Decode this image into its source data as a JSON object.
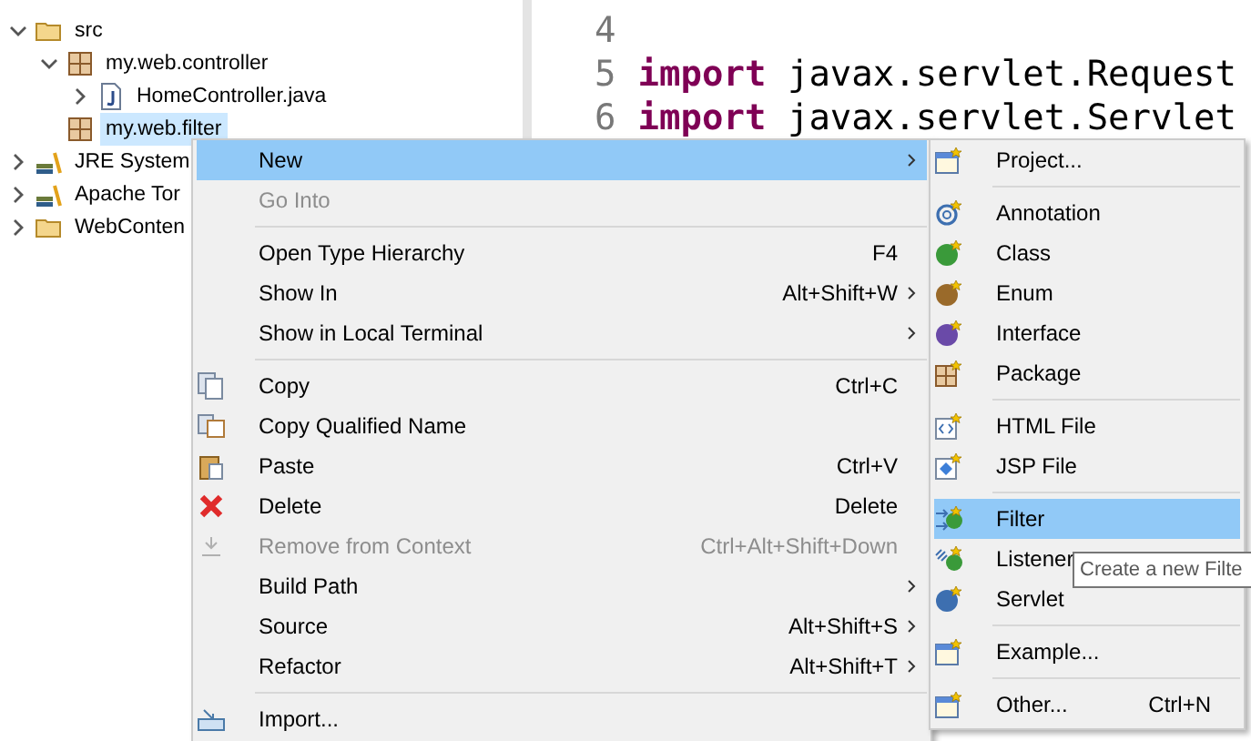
{
  "explorer": {
    "items": [
      {
        "label": "src",
        "kind": "folder",
        "expanded": true,
        "selected": false,
        "children": [
          {
            "label": "my.web.controller",
            "kind": "package",
            "expanded": true,
            "selected": false,
            "children": [
              {
                "label": "HomeController.java",
                "kind": "java",
                "expanded": false,
                "selected": false
              }
            ]
          },
          {
            "label": "my.web.filter",
            "kind": "package",
            "selected": true
          }
        ]
      },
      {
        "label": "JRE System",
        "kind": "library",
        "expanded": false,
        "selected": false
      },
      {
        "label": "Apache Tor",
        "kind": "library",
        "expanded": false,
        "selected": false
      },
      {
        "label": "WebConten",
        "kind": "folder",
        "expanded": false,
        "selected": false
      }
    ]
  },
  "editor": {
    "lines": [
      {
        "number": "4"
      },
      {
        "number": "5",
        "keyword": "import",
        "text": "javax.servlet.Request"
      },
      {
        "number": "6",
        "keyword": "import",
        "text": "javax.servlet.Servlet"
      }
    ]
  },
  "context_menu": {
    "items": [
      {
        "kind": "item",
        "label": "New",
        "selected": true,
        "disabled": false,
        "submenu": true
      },
      {
        "kind": "item",
        "label": "Go Into",
        "selected": false,
        "disabled": true,
        "submenu": false
      },
      {
        "kind": "separator"
      },
      {
        "kind": "item",
        "label": "Open Type Hierarchy",
        "shortcut": "F4",
        "selected": false,
        "disabled": false,
        "submenu": false
      },
      {
        "kind": "item",
        "label": "Show In",
        "shortcut": "Alt+Shift+W",
        "selected": false,
        "disabled": false,
        "submenu": true
      },
      {
        "kind": "item",
        "label": "Show in Local Terminal",
        "selected": false,
        "disabled": false,
        "submenu": true
      },
      {
        "kind": "separator"
      },
      {
        "kind": "item",
        "label": "Copy",
        "shortcut": "Ctrl+C",
        "selected": false,
        "disabled": false,
        "submenu": false
      },
      {
        "kind": "item",
        "label": "Copy Qualified Name",
        "selected": false,
        "disabled": false,
        "submenu": false
      },
      {
        "kind": "item",
        "label": "Paste",
        "shortcut": "Ctrl+V",
        "selected": false,
        "disabled": false,
        "submenu": false
      },
      {
        "kind": "item",
        "label": "Delete",
        "shortcut": "Delete",
        "selected": false,
        "disabled": false,
        "submenu": false
      },
      {
        "kind": "item",
        "label": "Remove from Context",
        "shortcut": "Ctrl+Alt+Shift+Down",
        "selected": false,
        "disabled": true,
        "submenu": false
      },
      {
        "kind": "item",
        "label": "Build Path",
        "selected": false,
        "disabled": false,
        "submenu": true
      },
      {
        "kind": "item",
        "label": "Source",
        "shortcut": "Alt+Shift+S",
        "selected": false,
        "disabled": false,
        "submenu": true
      },
      {
        "kind": "item",
        "label": "Refactor",
        "shortcut": "Alt+Shift+T",
        "selected": false,
        "disabled": false,
        "submenu": true
      },
      {
        "kind": "separator"
      },
      {
        "kind": "item",
        "label": "Import...",
        "selected": false,
        "disabled": false,
        "submenu": false
      }
    ]
  },
  "new_submenu": {
    "items": [
      {
        "kind": "item",
        "label": "Project...",
        "selected": false
      },
      {
        "kind": "separator"
      },
      {
        "kind": "item",
        "label": "Annotation",
        "selected": false
      },
      {
        "kind": "item",
        "label": "Class",
        "selected": false
      },
      {
        "kind": "item",
        "label": "Enum",
        "selected": false
      },
      {
        "kind": "item",
        "label": "Interface",
        "selected": false
      },
      {
        "kind": "item",
        "label": "Package",
        "selected": false
      },
      {
        "kind": "separator"
      },
      {
        "kind": "item",
        "label": "HTML File",
        "selected": false
      },
      {
        "kind": "item",
        "label": "JSP File",
        "selected": false
      },
      {
        "kind": "separator"
      },
      {
        "kind": "item",
        "label": "Filter",
        "selected": true
      },
      {
        "kind": "item",
        "label": "Listener",
        "selected": false
      },
      {
        "kind": "item",
        "label": "Servlet",
        "selected": false
      },
      {
        "kind": "separator"
      },
      {
        "kind": "item",
        "label": "Example...",
        "selected": false
      },
      {
        "kind": "separator"
      },
      {
        "kind": "item",
        "label": "Other...",
        "shortcut": "Ctrl+N",
        "selected": false
      }
    ]
  },
  "tooltip": {
    "text": "Create a new Filte"
  }
}
